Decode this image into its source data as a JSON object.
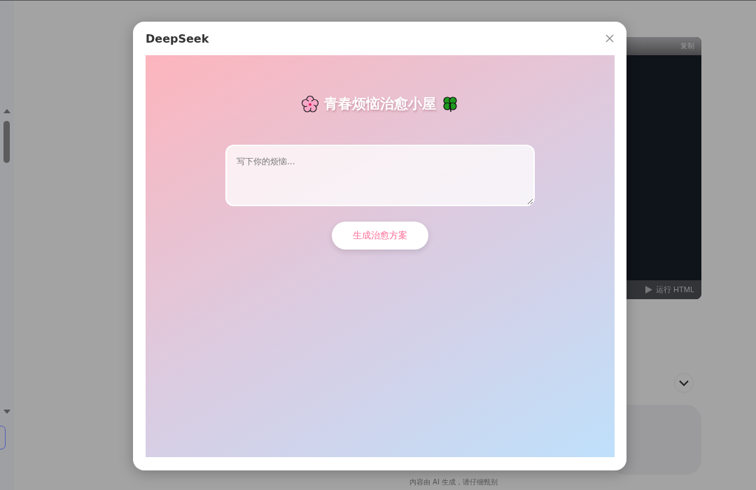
{
  "dialog": {
    "title": "DeepSeek",
    "preview": {
      "heading": "青春烦恼治愈小屋",
      "worry_field": {
        "placeholder": "写下你的烦恼..."
      },
      "generate_button": "生成治愈方案"
    }
  },
  "code_block": {
    "copy_button": "复制",
    "run_button": "运行 HTML"
  },
  "footer_note": "内容由 AI 生成，请仔细甄别"
}
